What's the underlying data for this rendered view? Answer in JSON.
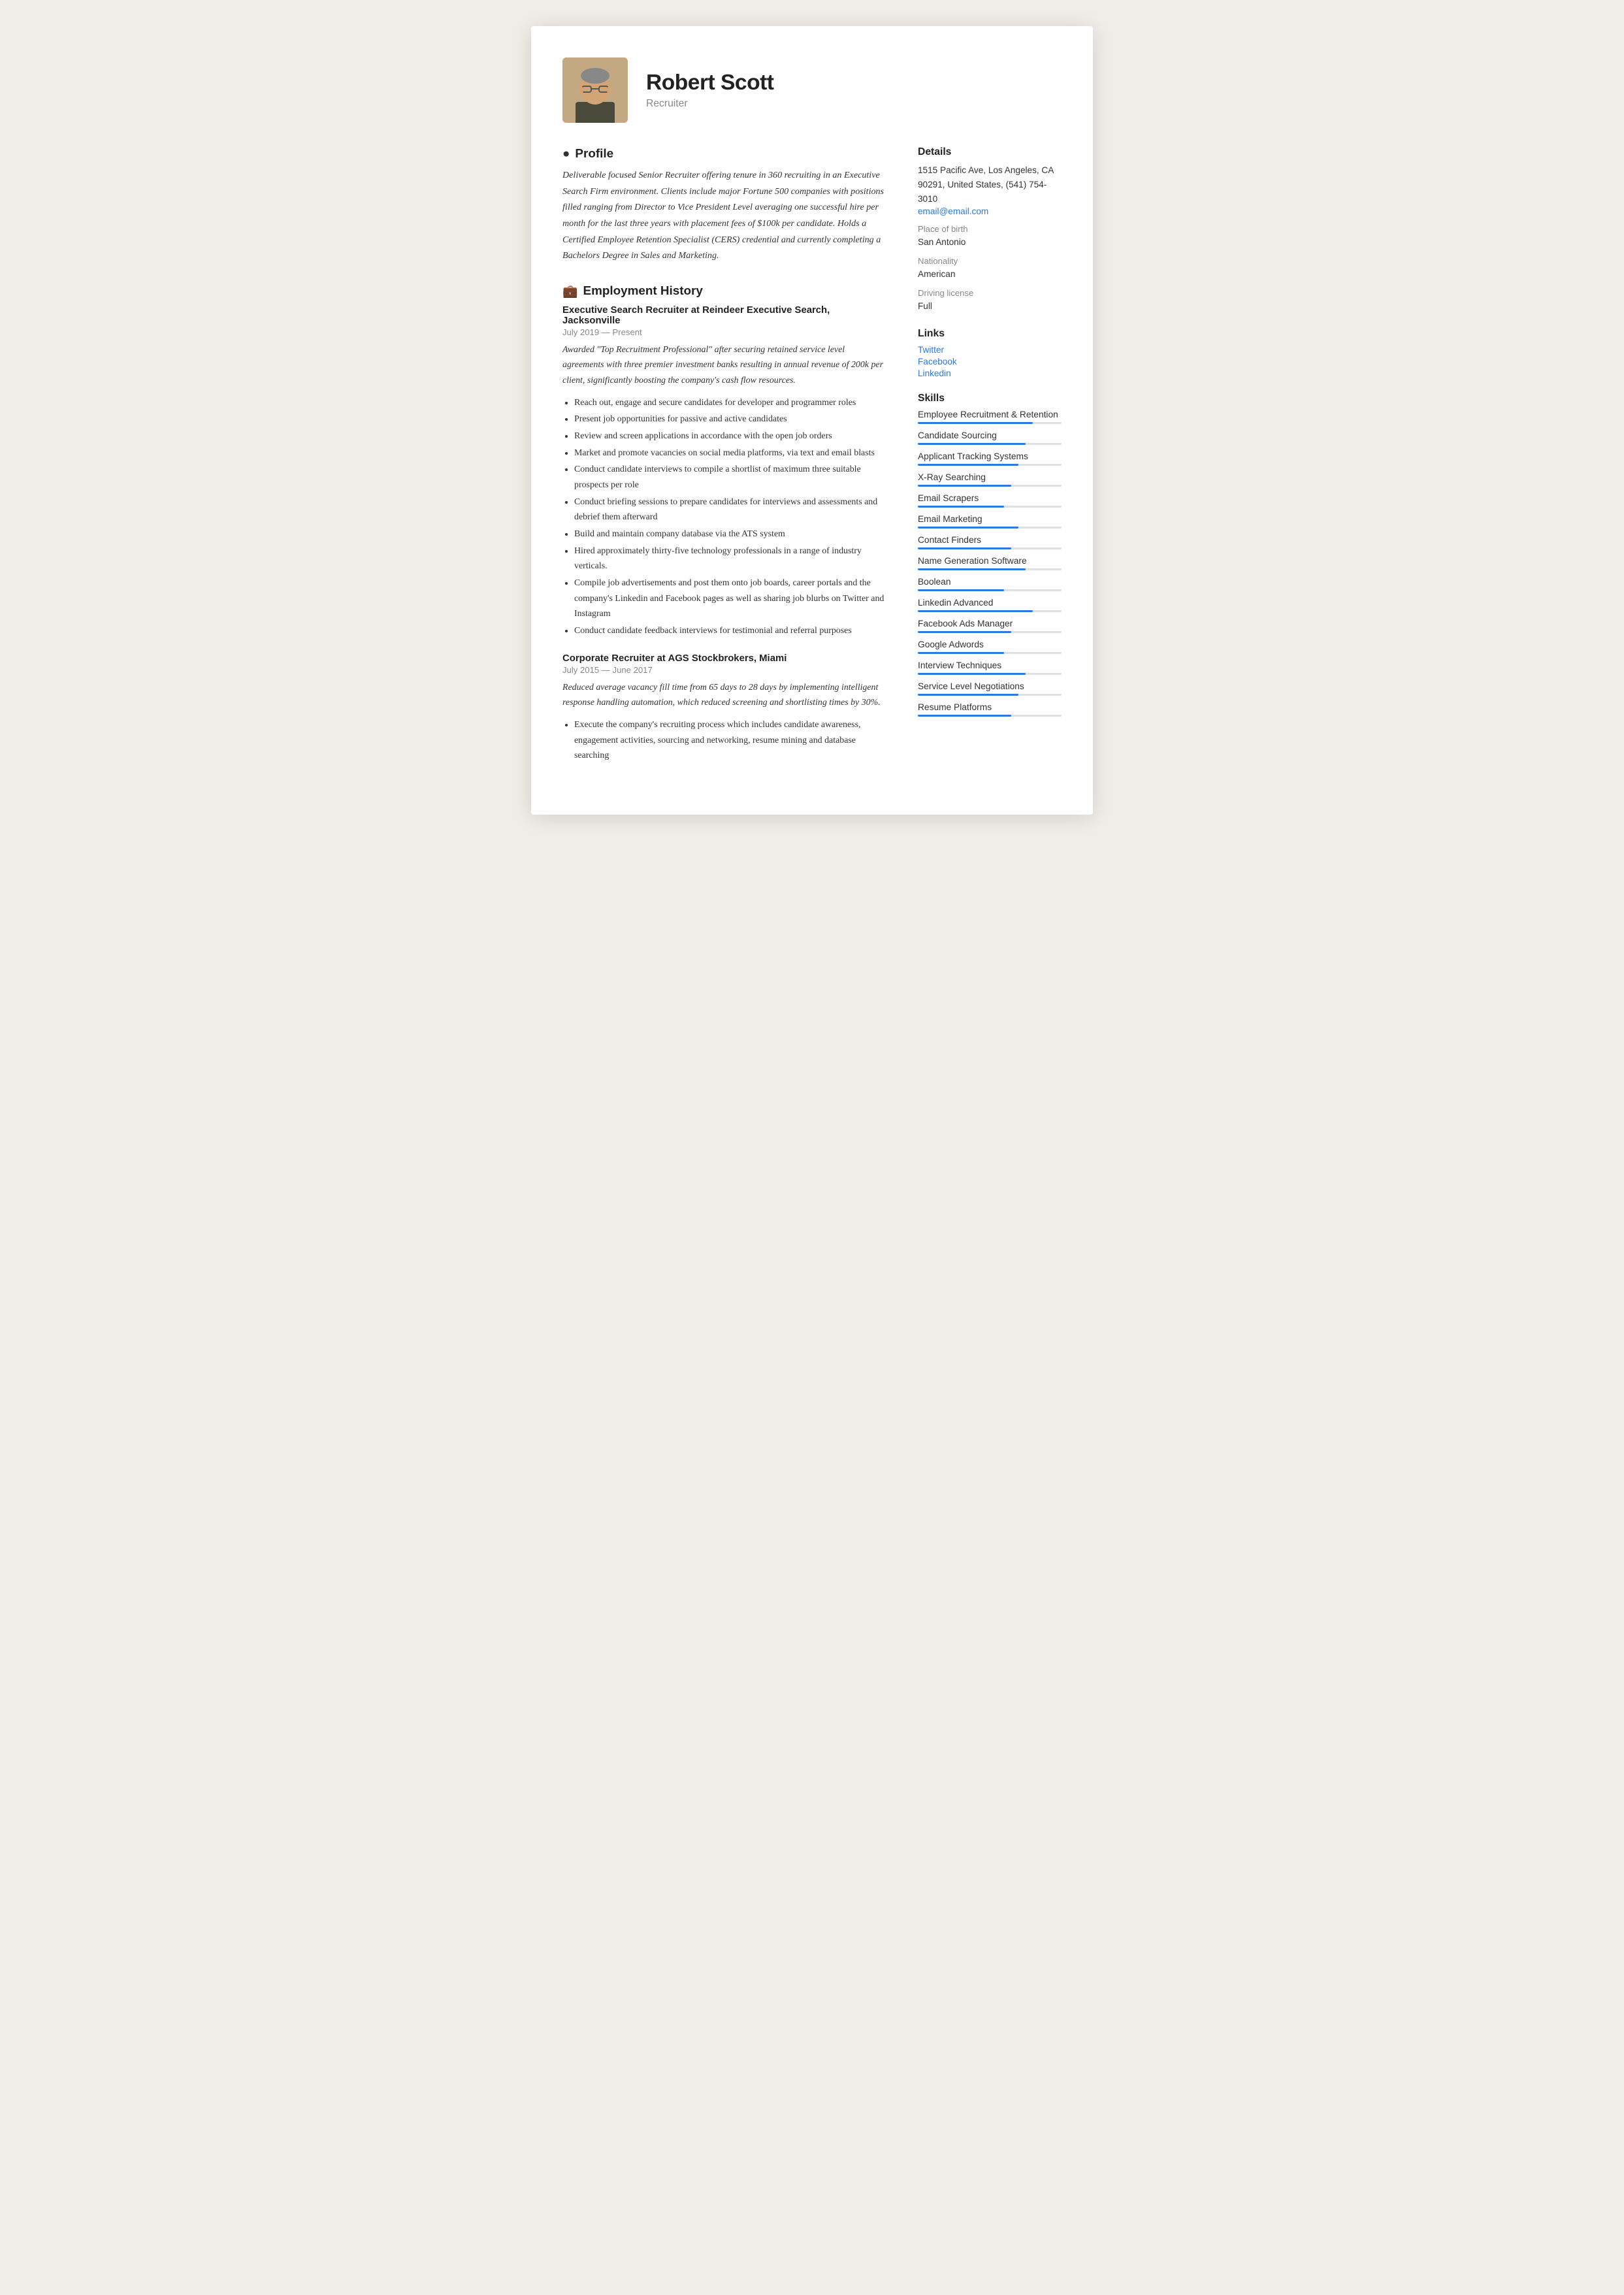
{
  "header": {
    "name": "Robert Scott",
    "subtitle": "Recruiter",
    "avatar_alt": "Robert Scott photo"
  },
  "profile": {
    "section_title": "Profile",
    "text": "Deliverable focused Senior Recruiter offering tenure in 360 recruiting in an Executive Search Firm environment. Clients include major Fortune 500 companies with positions filled ranging from Director to Vice President Level averaging one successful hire per month for the last three years with placement fees of $100k per candidate. Holds a Certified Employee Retention Specialist (CERS) credential and currently completing a Bachelors Degree in Sales and Marketing."
  },
  "employment": {
    "section_title": "Employment History",
    "jobs": [
      {
        "title": "Executive Search Recruiter at  Reindeer Executive Search, Jacksonville",
        "dates": "July 2019 — Present",
        "summary": "Awarded \"Top Recruitment Professional\" after securing retained service level agreements with three premier investment banks resulting in annual revenue of 200k per client, significantly boosting the company's cash flow resources.",
        "bullets": [
          "Reach out, engage and secure candidates for developer and programmer roles",
          "Present job opportunities for passive and active candidates",
          "Review and screen applications in accordance with the open job orders",
          "Market and promote vacancies on social media platforms, via text and email blasts",
          "Conduct candidate interviews to compile a shortlist of maximum three suitable prospects per role",
          "Conduct briefing sessions to prepare candidates for interviews and assessments and debrief them afterward",
          "Build and maintain company database via the ATS system",
          "Hired approximately thirty-five technology professionals in a range of industry verticals.",
          "Compile job advertisements and post them onto job boards, career portals and the company's Linkedin and Facebook pages as well as sharing job blurbs on Twitter and Instagram",
          "Conduct candidate feedback interviews for testimonial and referral purposes"
        ]
      },
      {
        "title": "Corporate Recruiter at  AGS Stockbrokers, Miami",
        "dates": "July 2015 — June 2017",
        "summary": "Reduced average vacancy fill time from 65 days to 28 days by implementing intelligent response handling automation, which reduced screening and shortlisting times by 30%.",
        "bullets": [
          "Execute the company's recruiting process which includes candidate awareness, engagement activities, sourcing and networking, resume mining and database searching"
        ]
      }
    ]
  },
  "details": {
    "section_title": "Details",
    "address": "1515 Pacific Ave, Los Angeles, CA 90291, United States, (541) 754-3010",
    "email": "email@email.com",
    "place_of_birth_label": "Place of birth",
    "place_of_birth": "San Antonio",
    "nationality_label": "Nationality",
    "nationality": "American",
    "driving_license_label": "Driving license",
    "driving_license": "Full"
  },
  "links": {
    "section_title": "Links",
    "items": [
      {
        "label": "Twitter",
        "url": "#"
      },
      {
        "label": "Facebook",
        "url": "#"
      },
      {
        "label": "Linkedin",
        "url": "#"
      }
    ]
  },
  "skills": {
    "section_title": "Skills",
    "items": [
      {
        "name": "Employee Recruitment & Retention",
        "level": 80
      },
      {
        "name": "Candidate Sourcing",
        "level": 75
      },
      {
        "name": "Applicant Tracking Systems",
        "level": 70
      },
      {
        "name": "X-Ray Searching",
        "level": 65
      },
      {
        "name": "Email Scrapers",
        "level": 60
      },
      {
        "name": "Email Marketing",
        "level": 70
      },
      {
        "name": "Contact Finders",
        "level": 65
      },
      {
        "name": "Name Generation Software",
        "level": 75
      },
      {
        "name": "Boolean",
        "level": 60
      },
      {
        "name": "Linkedin Advanced",
        "level": 80
      },
      {
        "name": "Facebook Ads Manager",
        "level": 65
      },
      {
        "name": "Google Adwords",
        "level": 60
      },
      {
        "name": "Interview Techniques",
        "level": 75
      },
      {
        "name": "Service Level Negotiations",
        "level": 70
      },
      {
        "name": "Resume Platforms",
        "level": 65
      }
    ]
  }
}
